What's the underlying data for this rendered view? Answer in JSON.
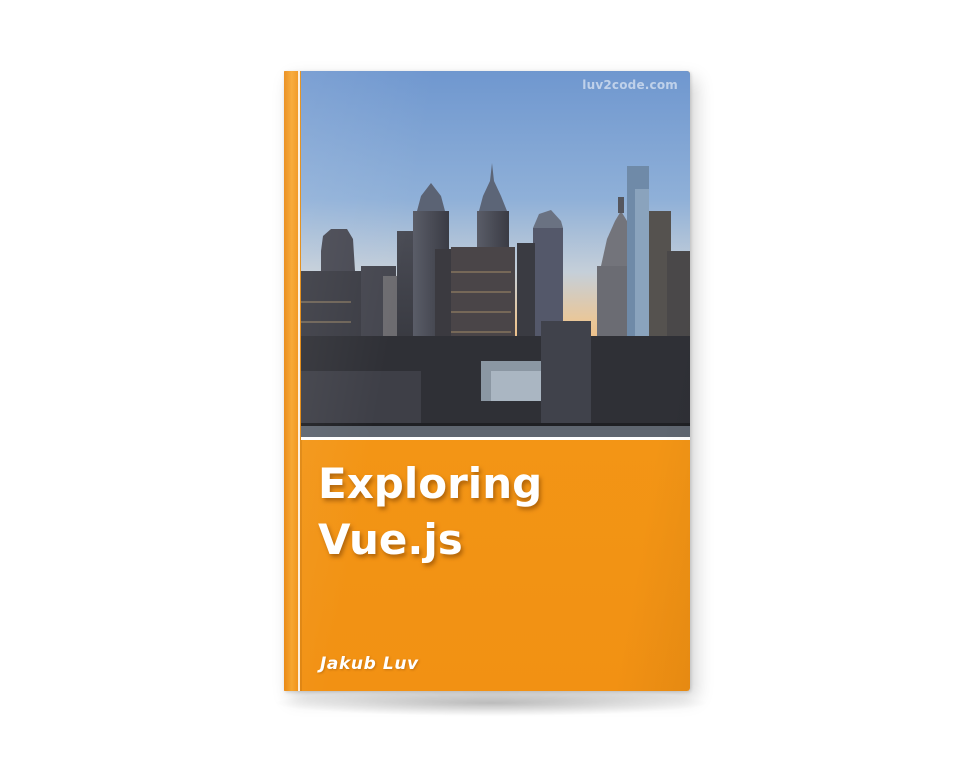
{
  "book": {
    "title_line1": "Exploring",
    "title_line2": "Vue.js",
    "author": "Jakub Luv",
    "watermark": "luv2code.com"
  },
  "colors": {
    "cover_orange": "#f29113",
    "title_text": "#ffffff",
    "sky_top": "#6f97cf",
    "sky_horizon": "#e9c79a"
  },
  "image": {
    "subject": "city-skyline-photo"
  }
}
